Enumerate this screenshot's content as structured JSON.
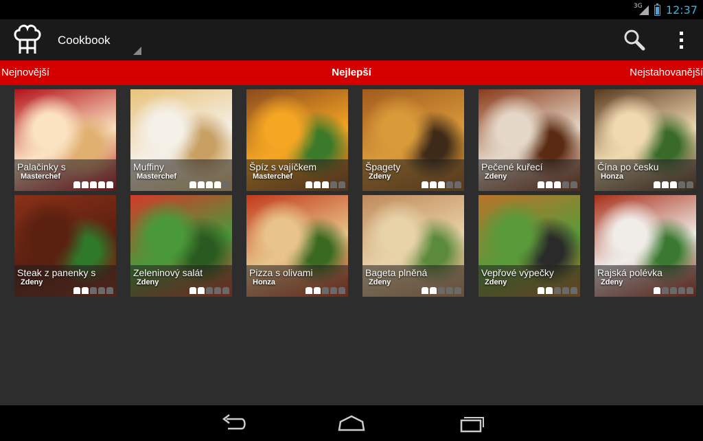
{
  "status_bar": {
    "network": "3G",
    "time": "12:37"
  },
  "action_bar": {
    "title": "Cookbook",
    "logo_icon": "chef-hat-icon",
    "search_icon": "search-icon",
    "overflow_icon": "overflow-menu-icon"
  },
  "tabs": {
    "left": "Nejnovější",
    "center": "Nejlepší",
    "right": "Nejstahovanější"
  },
  "recipes": [
    {
      "title": "Palačinky s",
      "author": "Masterchef",
      "rating": 5,
      "colors": [
        "#fbe3c2",
        "#b3121a",
        "#e0b070"
      ]
    },
    {
      "title": "Muffiny",
      "author": "Masterchef",
      "rating": 4,
      "colors": [
        "#f5f0e8",
        "#e8c27a",
        "#c8a064"
      ]
    },
    {
      "title": "Špíz s vajíčkem",
      "author": "Masterchef",
      "rating": 3,
      "colors": [
        "#f5a623",
        "#8b4a1d",
        "#3a7a2a"
      ]
    },
    {
      "title": "Špagety",
      "author": "Zdeny",
      "rating": 3,
      "colors": [
        "#d99a3a",
        "#a25b1d",
        "#3d2a18"
      ]
    },
    {
      "title": "Pečené kuřecí",
      "author": "Zdeny",
      "rating": 3,
      "colors": [
        "#e5d8c8",
        "#8a3a1a",
        "#5a2a12"
      ]
    },
    {
      "title": "Čína po česku",
      "author": "Honza",
      "rating": 3,
      "colors": [
        "#f0d9b0",
        "#5a3a20",
        "#3a6a2a"
      ]
    },
    {
      "title": "Steak z panenky s",
      "author": "Zdeny",
      "rating": 2,
      "colors": [
        "#5a2010",
        "#8a3018",
        "#2f7a2a"
      ]
    },
    {
      "title": "Zeleninový salát",
      "author": "Zdeny",
      "rating": 2,
      "colors": [
        "#4a9a3a",
        "#d23a2a",
        "#2a5a20"
      ]
    },
    {
      "title": "Pizza s olivami",
      "author": "Honza",
      "rating": 2,
      "colors": [
        "#e8c48a",
        "#c23a1a",
        "#3a6a20"
      ]
    },
    {
      "title": "Bageta plněná",
      "author": "Zdeny",
      "rating": 2,
      "colors": [
        "#e8d2a8",
        "#c08a5a",
        "#5a8a3a"
      ]
    },
    {
      "title": "Vepřové výpečky",
      "author": "Zdeny",
      "rating": 2,
      "colors": [
        "#5a9a3a",
        "#b8742a",
        "#2a2a2a"
      ]
    },
    {
      "title": "Rajská polévka",
      "author": "Zdeny",
      "rating": 1,
      "colors": [
        "#f0ece8",
        "#a8301a",
        "#3a7a30"
      ]
    }
  ],
  "max_rating": 5,
  "nav_bar": {
    "back_icon": "back-icon",
    "home_icon": "home-icon",
    "recents_icon": "recent-apps-icon"
  }
}
